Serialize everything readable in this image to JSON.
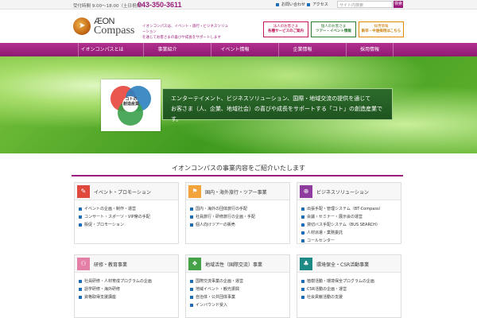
{
  "topbar": {
    "hours": "受付時間 9:00〜18:00（土日祝休）",
    "phone": "043-350-3611",
    "links": [
      "お問い合わせ",
      "アクセス"
    ],
    "search_placeholder": "サイト内検索",
    "search_label": "検索"
  },
  "header": {
    "logo_aeon": "ÆON",
    "logo_compass": "Compass",
    "tagline_1": "イオンコンパスは、イベント・旅行・ビジネスソリューション",
    "tagline_2": "を通じてお客さまの喜びや成長をサポートします",
    "boxes": [
      {
        "line1": "法人のお客さま",
        "line2": "各種サービスのご案内",
        "color": "#c2185b"
      },
      {
        "line1": "個人のお客さま",
        "line2": "ツアー・イベント情報",
        "color": "#2e7d32"
      },
      {
        "line1": "採用情報",
        "line2": "新卒・中途採用はこちら",
        "color": "#e08a00"
      }
    ]
  },
  "nav": {
    "items": [
      "イオンコンパスとは",
      "事業紹介",
      "イベント情報",
      "企業情報",
      "採用情報"
    ]
  },
  "hero": {
    "diagram_labels": [
      "コト",
      "の",
      "創造産業"
    ],
    "line1": "エンターテイメント、ビジネスソリューション、国際・地域交流の提供を通じて",
    "line2": "お客さま（人、企業、地域社会）の喜びや成長をサポートする「コト」の創造産業です。"
  },
  "section": {
    "title": "イオンコンパスの事業内容をご紹介いたします"
  },
  "cards": [
    {
      "title": "イベント・プロモーション",
      "icon": "pencil-icon",
      "color": "#e0483e",
      "items": [
        "イベントの企画・制作・運営",
        "コンサート・スポーツ・VIP席の手配",
        "販促・プロモーション"
      ]
    },
    {
      "title": "国内・海外旅行・ツアー事業",
      "icon": "flag-icon",
      "color": "#f2a33a",
      "items": [
        "国内・海外の団体旅行の手配",
        "社員旅行・研修旅行の企画・手配",
        "個人向けツアーの販売"
      ]
    },
    {
      "title": "ビジネスソリューション",
      "icon": "globe-icon",
      "color": "#8e3c9e",
      "items": [
        "出張手配・管理システム（BT-Compass）",
        "会議・セミナー・展示会の運営",
        "貸切バス手配システム（BUS SEARCH）",
        "人材派遣・業務委託",
        "コールセンター"
      ]
    },
    {
      "title": "研修・教育事業",
      "icon": "people-icon",
      "color": "#e67fa8",
      "items": [
        "社員研修・人材育成プログラムの企画",
        "語学研修・海外研修",
        "資格取得支援講座"
      ]
    },
    {
      "title": "地域活性（国際交流）事業",
      "icon": "gift-icon",
      "color": "#45a249",
      "items": [
        "国際交流事業の企画・運営",
        "地域イベント・観光振興",
        "自治体・公共団体事業",
        "インバウンド受入"
      ]
    },
    {
      "title": "環境保全・CSR活動事業",
      "icon": "tree-icon",
      "color": "#1e8a86",
      "items": [
        "植樹活動・環境保全プログラムの企画",
        "CSR活動の企画・運営",
        "社会貢献活動の支援"
      ]
    }
  ]
}
